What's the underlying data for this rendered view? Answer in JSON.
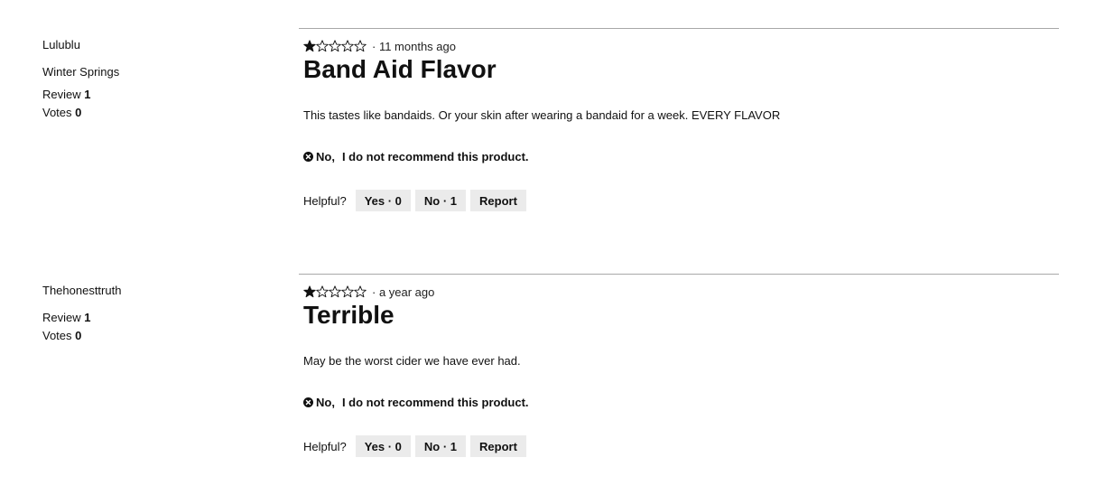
{
  "reviews": [
    {
      "username": "Lulublu",
      "location": "Winter Springs",
      "review_label": "Review",
      "review_count": "1",
      "votes_label": "Votes",
      "votes_count": "0",
      "rating": 1,
      "rating_max": 5,
      "time": "· 11 months ago",
      "title": "Band Aid Flavor",
      "body": "This tastes like bandaids. Or your skin after wearing a bandaid for a week. EVERY FLAVOR",
      "recommend_no": "No,",
      "recommend_text": "I do not recommend this product.",
      "helpful_label": "Helpful?",
      "yes_label": "Yes · 0",
      "no_label": "No · 1",
      "report_label": "Report"
    },
    {
      "username": "Thehonesttruth",
      "review_label": "Review",
      "review_count": "1",
      "votes_label": "Votes",
      "votes_count": "0",
      "rating": 1,
      "rating_max": 5,
      "time": "· a year ago",
      "title": "Terrible",
      "body": "May be the worst cider we have ever had.",
      "recommend_no": "No,",
      "recommend_text": "I do not recommend this product.",
      "helpful_label": "Helpful?",
      "yes_label": "Yes · 0",
      "no_label": "No · 1",
      "report_label": "Report"
    }
  ]
}
